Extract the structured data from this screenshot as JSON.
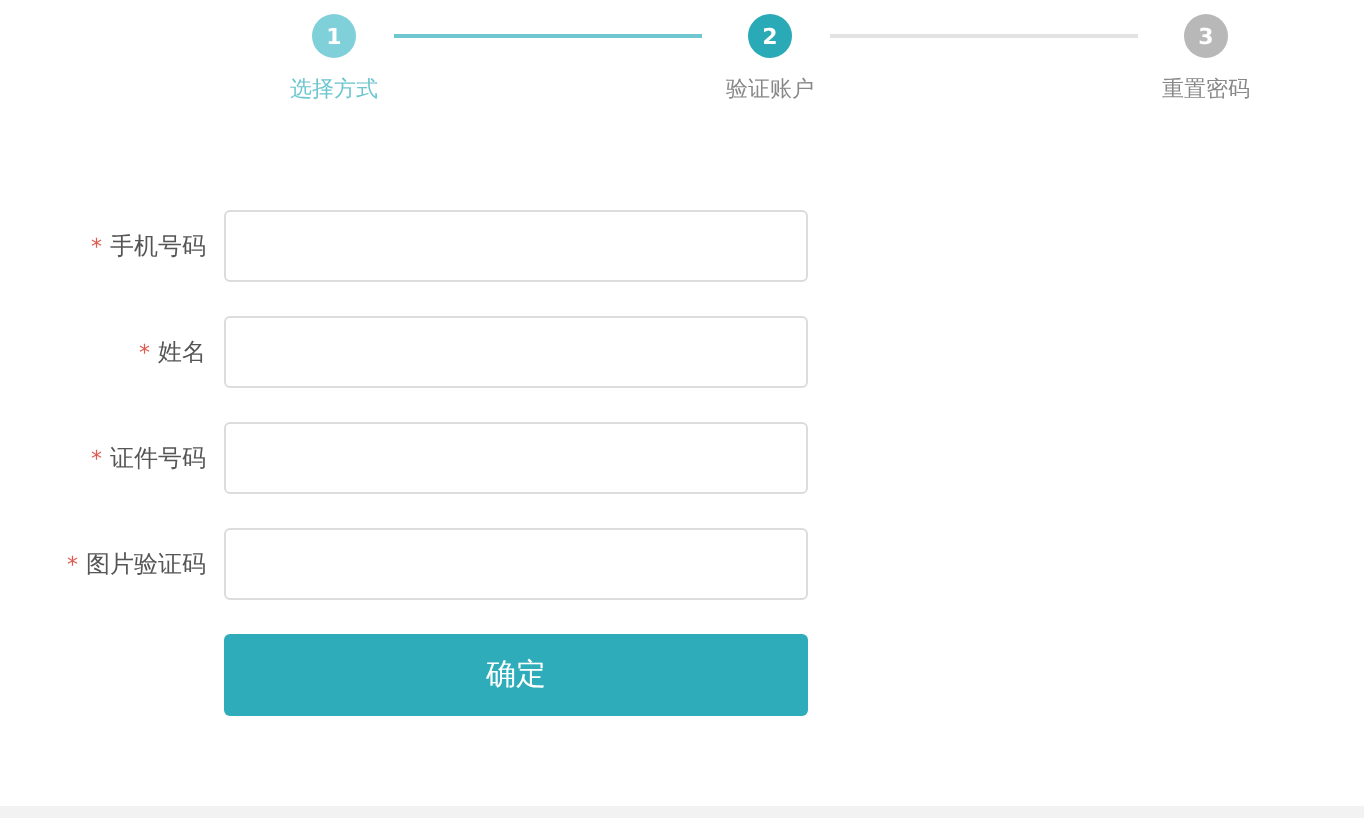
{
  "steps": [
    {
      "number": "1",
      "label": "选择方式",
      "done": true,
      "selected": false
    },
    {
      "number": "2",
      "label": "验证账户",
      "done": false,
      "selected": true
    },
    {
      "number": "3",
      "label": "重置密码",
      "done": false,
      "selected": false
    }
  ],
  "fields": [
    {
      "marker": "*",
      "label": "手机号码"
    },
    {
      "marker": "*",
      "label": "姓名"
    },
    {
      "marker": "*",
      "label": "证件号码"
    },
    {
      "marker": "*",
      "label": "图片验证码"
    }
  ],
  "submit_button": "确定"
}
